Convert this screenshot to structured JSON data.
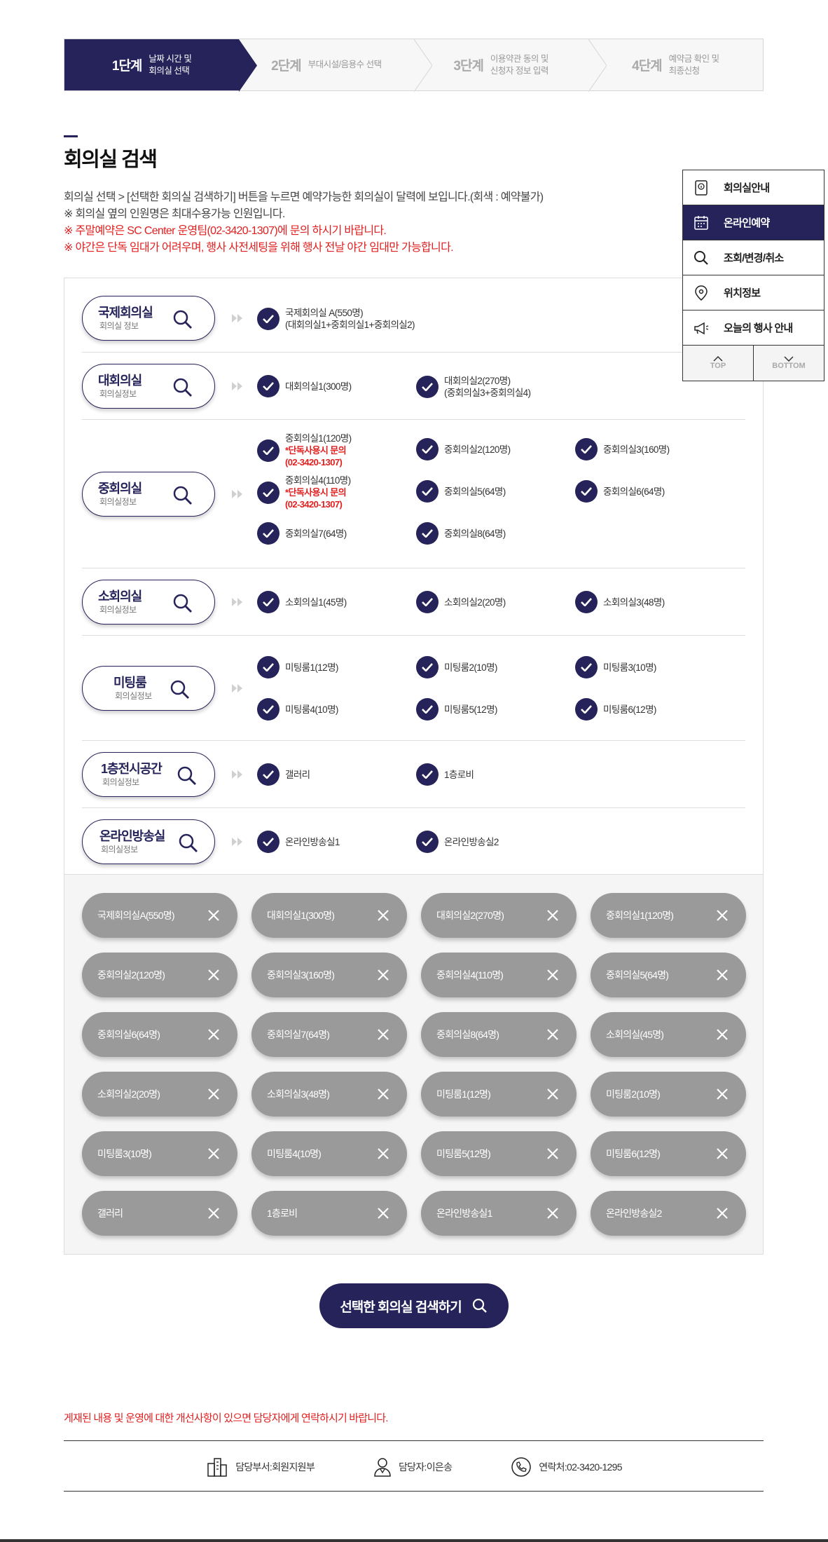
{
  "steps": [
    {
      "num": "1단계",
      "desc1": "날짜 시간 및",
      "desc2": "회의실 선택"
    },
    {
      "num": "2단계",
      "desc1": "부대시설/음용수 선택",
      "desc2": ""
    },
    {
      "num": "3단계",
      "desc1": "이용약관 동의 및",
      "desc2": "신청자 정보 입력"
    },
    {
      "num": "4단계",
      "desc1": "예약금 확인 및",
      "desc2": "최종신청"
    }
  ],
  "page_title": "회의실 검색",
  "intro": {
    "line1": "회의실 선택 > [선택한 회의실 검색하기] 버튼을 누르면 예약가능한 회의실이 달력에 보입니다.(회색 : 예약불가)",
    "line2": "※ 회의실 옆의 인원명은 최대수용가능 인원입니다.",
    "line3": "※ 주말예약은 SC Center 운영팀(02-3420-1307)에 문의 하시기 바랍니다.",
    "line4": "※ 야간은 단독 임대가 어려우며, 행사 사전세팅을 위해 행사 전날 야간 임대만 가능합니다."
  },
  "sidepanel": {
    "items": [
      "회의실안내",
      "온라인예약",
      "조회/변경/취소",
      "위치정보",
      "오늘의 행사 안내"
    ],
    "top": "TOP",
    "bottom": "BOTTOM"
  },
  "categories": [
    {
      "title": "국제회의실",
      "sub": "회의실 정보",
      "rooms": [
        {
          "label": "국제회의실 A(550명)",
          "label2": "(대회의실1+중회의실1+중회의실2)"
        }
      ]
    },
    {
      "title": "대회의실",
      "sub": "회의실정보",
      "rooms": [
        {
          "label": "대회의실1(300명)"
        },
        {
          "label": "대회의실2(270명)",
          "label2": "(중회의실3+중회의실4)"
        }
      ]
    },
    {
      "title": "중회의실",
      "sub": "회의실정보",
      "rooms": [
        {
          "label": "중회의실1(120명)",
          "warn1": "*단독사용시 문의",
          "warn2": "(02-3420-1307)"
        },
        {
          "label": "중회의실2(120명)"
        },
        {
          "label": "중회의실3(160명)"
        },
        {
          "label": "중회의실4(110명)",
          "warn1": "*단독사용시 문의",
          "warn2": "(02-3420-1307)"
        },
        {
          "label": "중회의실5(64명)"
        },
        {
          "label": "중회의실6(64명)"
        },
        {
          "label": "중회의실7(64명)"
        },
        {
          "label": "중회의실8(64명)"
        }
      ]
    },
    {
      "title": "소회의실",
      "sub": "회의실정보",
      "rooms": [
        {
          "label": "소회의실1(45명)"
        },
        {
          "label": "소회의실2(20명)"
        },
        {
          "label": "소회의실3(48명)"
        }
      ]
    },
    {
      "title": "미팅룸",
      "sub": "회의실정보",
      "rooms": [
        {
          "label": "미팅룸1(12명)"
        },
        {
          "label": "미팅룸2(10명)"
        },
        {
          "label": "미팅룸3(10명)"
        },
        {
          "label": "미팅룸4(10명)"
        },
        {
          "label": "미팅룸5(12명)"
        },
        {
          "label": "미팅룸6(12명)"
        }
      ]
    },
    {
      "title": "1층전시공간",
      "sub": "회의실정보",
      "rooms": [
        {
          "label": "갤러리"
        },
        {
          "label": "1층로비"
        }
      ]
    },
    {
      "title": "온라인방송실",
      "sub": "회의실정보",
      "rooms": [
        {
          "label": "온라인방송실1"
        },
        {
          "label": "온라인방송실2"
        }
      ]
    }
  ],
  "selected_tags": [
    "국제회의실A(550명)",
    "대회의실1(300명)",
    "대회의실2(270명)",
    "중회의실1(120명)",
    "중회의실2(120명)",
    "중회의실3(160명)",
    "중회의실4(110명)",
    "중회의실5(64명)",
    "중회의실6(64명)",
    "중회의실7(64명)",
    "중회의실8(64명)",
    "소회의실(45명)",
    "소회의실2(20명)",
    "소회의실3(48명)",
    "미팅룸1(12명)",
    "미팅룸2(10명)",
    "미팅룸3(10명)",
    "미팅룸4(10명)",
    "미팅룸5(12명)",
    "미팅룸6(12명)",
    "갤러리",
    "1층로비",
    "온라인방송실1",
    "온라인방송실2"
  ],
  "search_button": "선택한 회의실 검색하기",
  "footer": {
    "notice": "게재된 내용 및 운영에 대한 개선사항이 있으면 담당자에게 연락하시기 바랍니다.",
    "dept": "담당부서:회원지원부",
    "person": "담당자:이은송",
    "phone": "연락처:02-3420-1295"
  },
  "colors": {
    "navy": "#26235a",
    "red": "#e02020",
    "tag_gray": "#9a9a9a"
  }
}
